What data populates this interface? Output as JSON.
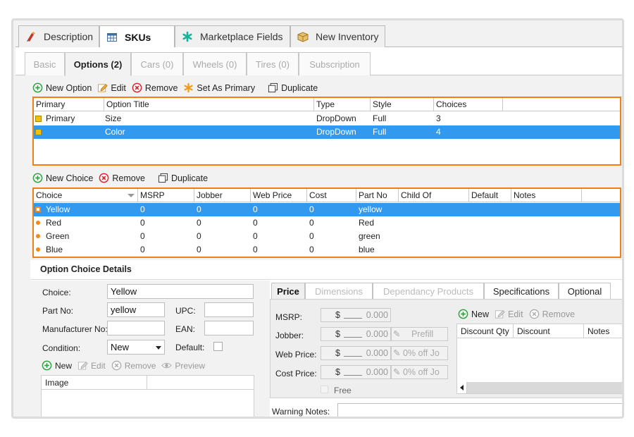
{
  "top_tabs": [
    {
      "label": "Description",
      "icon": "description-icon"
    },
    {
      "label": "SKUs",
      "icon": "grid-icon"
    },
    {
      "label": "Marketplace Fields",
      "icon": "asterisk-icon"
    },
    {
      "label": "New Inventory",
      "icon": "box-icon"
    }
  ],
  "sub_tabs": [
    "Basic",
    "Options (2)",
    "Cars (0)",
    "Wheels (0)",
    "Tires (0)",
    "Subscription"
  ],
  "options_toolbar": {
    "new": "New Option",
    "edit": "Edit",
    "remove": "Remove",
    "set_primary": "Set As Primary",
    "duplicate": "Duplicate"
  },
  "options_grid": {
    "columns": [
      "Primary",
      "Option Title",
      "Type",
      "Style",
      "Choices"
    ],
    "rows": [
      {
        "primary": "Primary",
        "title": "Size",
        "type": "DropDown",
        "style": "Full",
        "choices": "3"
      },
      {
        "primary": "",
        "title": "Color",
        "type": "DropDown",
        "style": "Full",
        "choices": "4"
      }
    ]
  },
  "choices_toolbar": {
    "new": "New Choice",
    "remove": "Remove",
    "duplicate": "Duplicate"
  },
  "choices_grid": {
    "columns": [
      "Choice",
      "MSRP",
      "Jobber",
      "Web Price",
      "Cost",
      "Part No",
      "Child Of",
      "Default",
      "Notes"
    ],
    "rows": [
      {
        "choice": "Yellow",
        "msrp": "0",
        "jobber": "0",
        "web": "0",
        "cost": "0",
        "part": "yellow"
      },
      {
        "choice": "Red",
        "msrp": "0",
        "jobber": "0",
        "web": "0",
        "cost": "0",
        "part": "Red"
      },
      {
        "choice": "Green",
        "msrp": "0",
        "jobber": "0",
        "web": "0",
        "cost": "0",
        "part": "green"
      },
      {
        "choice": "Blue",
        "msrp": "0",
        "jobber": "0",
        "web": "0",
        "cost": "0",
        "part": "blue"
      }
    ]
  },
  "details": {
    "title": "Option Choice Details",
    "choice_label": "Choice:",
    "choice_value": "Yellow",
    "partno_label": "Part No:",
    "partno_value": "yellow",
    "upc_label": "UPC:",
    "mfr_label": "Manufacturer No:",
    "ean_label": "EAN:",
    "condition_label": "Condition:",
    "condition_value": "New",
    "default_label": "Default:",
    "img_new": "New",
    "img_edit": "Edit",
    "img_remove": "Remove",
    "img_preview": "Preview",
    "image_col": "Image"
  },
  "price_tabs": [
    "Price",
    "Dimensions",
    "Dependancy Products",
    "Specifications",
    "Optional"
  ],
  "price": {
    "msrp_label": "MSRP:",
    "jobber_label": "Jobber:",
    "web_label": "Web Price:",
    "cost_label": "Cost Price:",
    "currency": "$",
    "msrp": "0.000",
    "jobber": "0.000",
    "web": "0.000",
    "cost": "0.000",
    "prefill": "Prefill",
    "web_off": "0% off Jo",
    "cost_off": "0% off Jo",
    "free_label": "Free"
  },
  "discount": {
    "new": "New",
    "edit": "Edit",
    "remove": "Remove",
    "columns": [
      "Discount Qty",
      "Discount",
      "Notes"
    ]
  },
  "warning_label": "Warning Notes:",
  "colors": {
    "accent_border": "#f07f1a",
    "selection": "#3399ee",
    "green_icon": "#2aa53a",
    "red_icon": "#d9262c"
  }
}
